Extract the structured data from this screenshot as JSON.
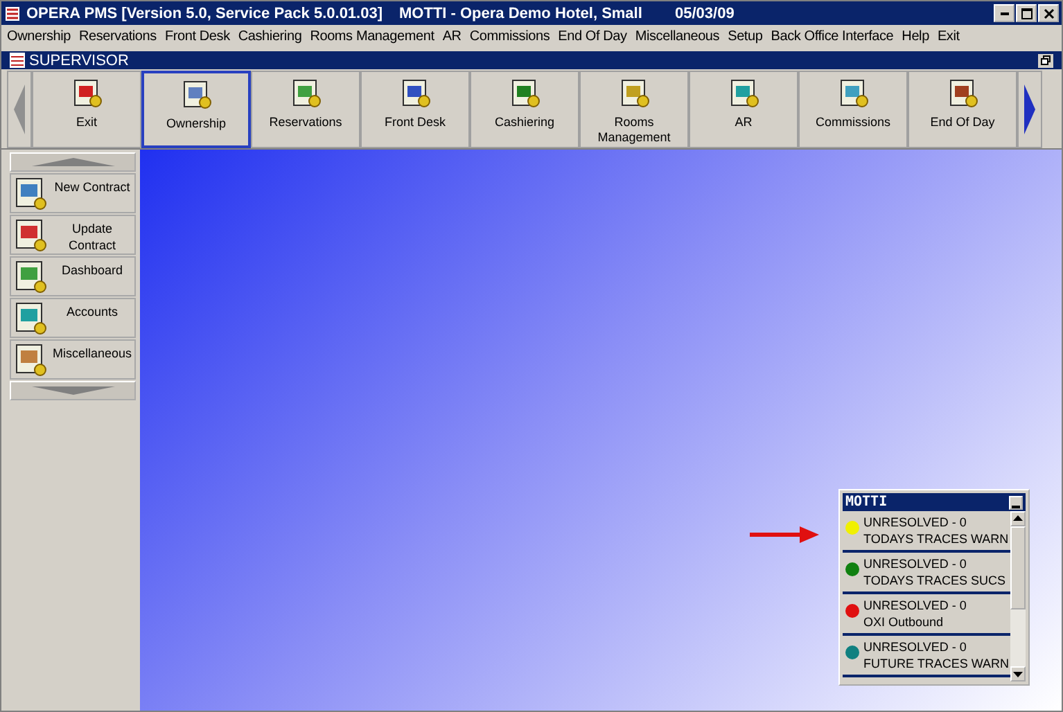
{
  "window": {
    "title": "OPERA PMS [Version 5.0, Service Pack 5.0.01.03]",
    "user_hotel": "MOTTI - Opera Demo Hotel, Small",
    "date": "05/03/09"
  },
  "menu": [
    "Ownership",
    "Reservations",
    "Front Desk",
    "Cashiering",
    "Rooms Management",
    "AR",
    "Commissions",
    "End Of Day",
    "Miscellaneous",
    "Setup",
    "Back Office Interface",
    "Help",
    "Exit"
  ],
  "subwindow": {
    "title": "SUPERVISOR"
  },
  "toolbar": [
    {
      "label": "Exit",
      "kind": "exit",
      "selected": false
    },
    {
      "label": "Ownership",
      "kind": "ownership",
      "selected": true
    },
    {
      "label": "Reservations",
      "kind": "reservations",
      "selected": false
    },
    {
      "label": "Front Desk",
      "kind": "frontdesk",
      "selected": false
    },
    {
      "label": "Cashiering",
      "kind": "cashiering",
      "selected": false
    },
    {
      "label": "Rooms Management",
      "kind": "rooms",
      "selected": false
    },
    {
      "label": "AR",
      "kind": "ar",
      "selected": false
    },
    {
      "label": "Commissions",
      "kind": "commissions",
      "selected": false
    },
    {
      "label": "End Of Day",
      "kind": "endofday",
      "selected": false
    }
  ],
  "sidebar": {
    "items": [
      {
        "label": "New Contract",
        "kind": "newcontract"
      },
      {
        "label": "Update Contract",
        "kind": "updatecontract"
      },
      {
        "label": "Dashboard",
        "kind": "dashboard"
      },
      {
        "label": "Accounts",
        "kind": "accounts"
      },
      {
        "label": "Miscellaneous",
        "kind": "misc"
      }
    ]
  },
  "motti_panel": {
    "title": "MOTTI",
    "items": [
      {
        "status": "UNRESOLVED - 0",
        "label": "TODAYS TRACES WARN",
        "color": "#f0f000"
      },
      {
        "status": "UNRESOLVED - 0",
        "label": "TODAYS TRACES SUCS",
        "color": "#108010"
      },
      {
        "status": "UNRESOLVED - 0",
        "label": "OXI Outbound",
        "color": "#e01010"
      },
      {
        "status": "UNRESOLVED - 0",
        "label": "FUTURE TRACES WARN",
        "color": "#108080"
      }
    ]
  }
}
